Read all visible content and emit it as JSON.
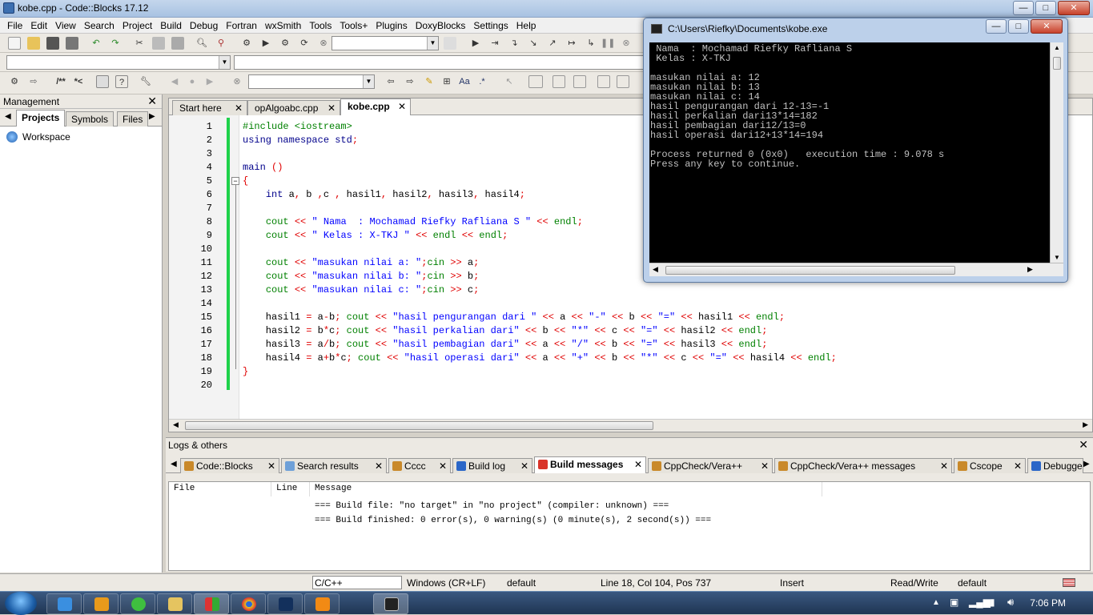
{
  "window": {
    "title": "kobe.cpp - Code::Blocks 17.12"
  },
  "menu": [
    "File",
    "Edit",
    "View",
    "Search",
    "Project",
    "Build",
    "Debug",
    "Fortran",
    "wxSmith",
    "Tools",
    "Tools+",
    "Plugins",
    "DoxyBlocks",
    "Settings",
    "Help"
  ],
  "toolbar": {
    "doxy_left": "/**",
    "doxy_right": "*<"
  },
  "management": {
    "title": "Management",
    "tabs": [
      "Projects",
      "Symbols",
      "Files"
    ],
    "tree_root": "Workspace"
  },
  "editor": {
    "tabs": [
      "Start here",
      "opAlgoabc.cpp",
      "kobe.cpp"
    ],
    "line_numbers": [
      "1",
      "2",
      "3",
      "4",
      "5",
      "6",
      "7",
      "8",
      "9",
      "10",
      "11",
      "12",
      "13",
      "14",
      "15",
      "16",
      "17",
      "18",
      "19",
      "20"
    ]
  },
  "logs": {
    "title": "Logs & others",
    "tabs": [
      "Code::Blocks",
      "Search results",
      "Cccc",
      "Build log",
      "Build messages",
      "CppCheck/Vera++",
      "CppCheck/Vera++ messages",
      "Cscope",
      "Debugge"
    ],
    "columns": [
      "File",
      "Line",
      "Message"
    ],
    "rows": [
      "=== Build file: \"no target\" in \"no project\" (compiler: unknown) ===",
      "=== Build finished: 0 error(s), 0 warning(s) (0 minute(s), 2 second(s)) ==="
    ]
  },
  "status": {
    "lang": "C/C++",
    "eol": "Windows (CR+LF)",
    "encoding": "default",
    "position": "Line 18, Col 104, Pos 737",
    "mode": "Insert",
    "access": "Read/Write",
    "extra": "default"
  },
  "console": {
    "title": "C:\\Users\\Riefky\\Documents\\kobe.exe",
    "lines": [
      " Nama  : Mochamad Riefky Rafliana S",
      " Kelas : X-TKJ",
      "",
      "masukan nilai a: 12",
      "masukan nilai b: 13",
      "masukan nilai c: 14",
      "hasil pengurangan dari 12-13=-1",
      "hasil perkalian dari13*14=182",
      "hasil pembagian dari12/13=0",
      "hasil operasi dari12+13*14=194",
      "",
      "Process returned 0 (0x0)   execution time : 9.078 s",
      "Press any key to continue."
    ]
  },
  "taskbar": {
    "clock": "7:06 PM"
  },
  "colors": {
    "accent_green": "#1fd24b",
    "keyword": "#00008b",
    "string": "#0000ff",
    "operator": "#e00000",
    "preprocessor": "#008000"
  }
}
